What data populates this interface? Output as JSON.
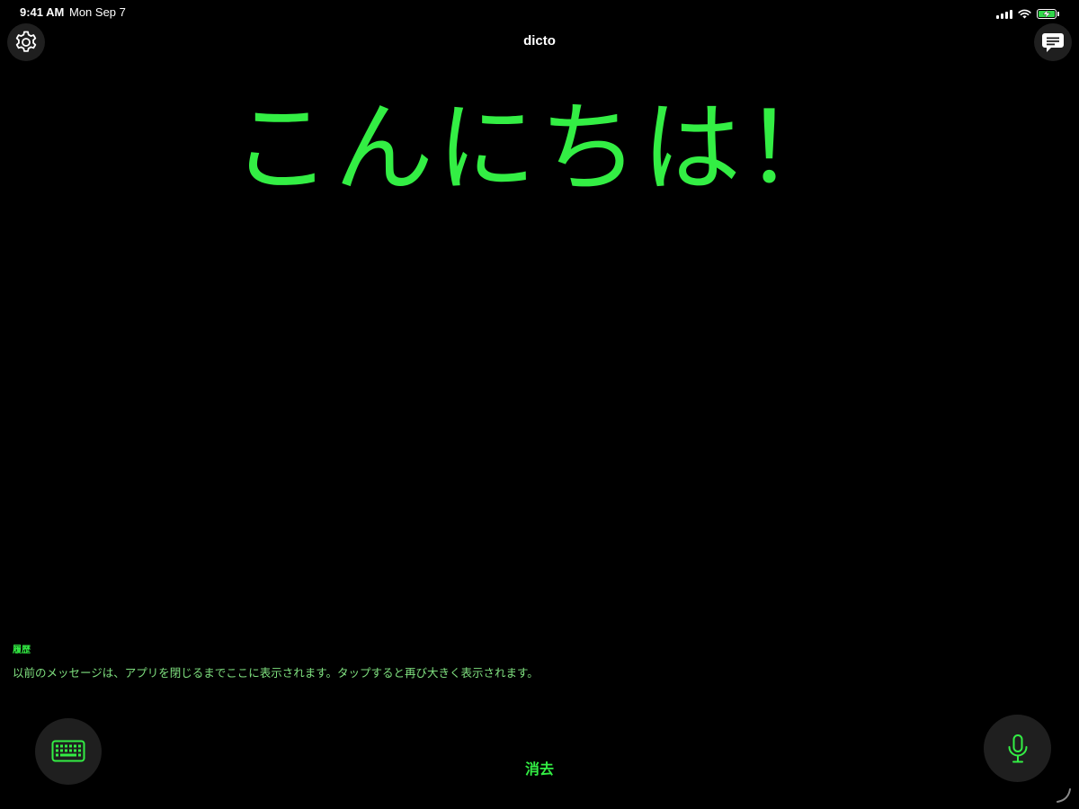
{
  "status_bar": {
    "time": "9:41 AM",
    "date": "Mon Sep 7"
  },
  "header": {
    "title": "dicto",
    "settings_icon": "gear-icon",
    "chat_icon": "chat-bubble-icon"
  },
  "main": {
    "message": "こんにちは！"
  },
  "history": {
    "title": "履歴",
    "description": "以前のメッセージは、アプリを閉じるまでここに表示されます。タップすると再び大きく表示されます。"
  },
  "footer": {
    "clear_label": "消去",
    "keyboard_icon": "keyboard-icon",
    "mic_icon": "microphone-icon"
  },
  "colors": {
    "background": "#000000",
    "accent": "#33ee44",
    "button_bg": "#1f1f1f"
  }
}
